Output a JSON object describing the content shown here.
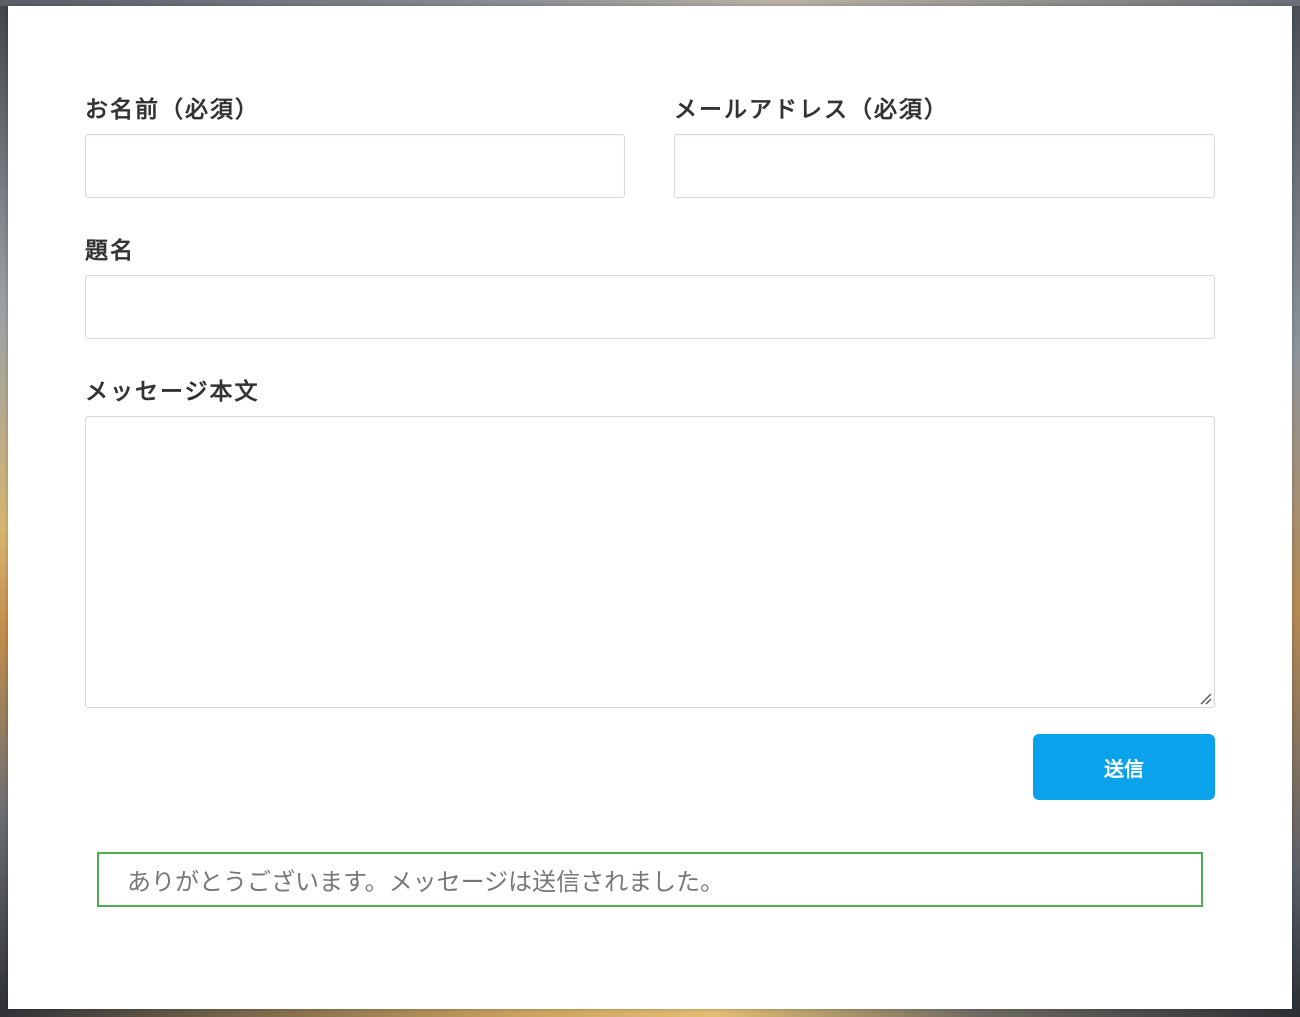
{
  "form": {
    "name_label": "お名前（必須）",
    "email_label": "メールアドレス（必須）",
    "subject_label": "題名",
    "message_label": "メッセージ本文",
    "name_value": "",
    "email_value": "",
    "subject_value": "",
    "message_value": "",
    "submit_label": "送信"
  },
  "notice": {
    "text": "ありがとうございます。メッセージは送信されました。"
  },
  "colors": {
    "submit": "#0aa2ea",
    "notice_border": "#4caf50",
    "label_text": "#333333",
    "notice_text": "#777777"
  }
}
